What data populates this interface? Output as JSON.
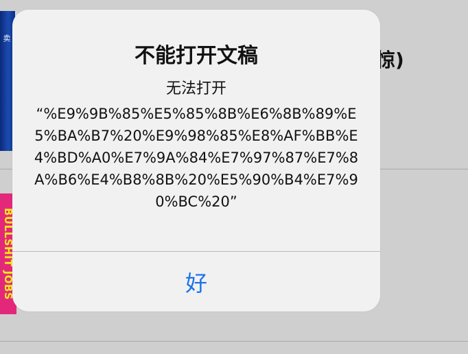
{
  "background": {
    "title_fragment": "惊)",
    "top_cover_edge_text": "卖",
    "bottom_cover_spine_text": "BULLSHIT JOBS"
  },
  "alert": {
    "title": "不能打开文稿",
    "message_intro": "无法打开",
    "message_body": "“%E9%9B%85%E5%85%8B%E6%8B%89%E5%BA%B7%20%E9%98%85%E8%AF%BB%E4%BD%A0%E7%9A%84%E7%97%87%E7%8A%B6%E4%B8%8B%20%E5%90%B4%E7%90%BC%20”",
    "ok_button": "好"
  },
  "colors": {
    "accent": "#1b73e8",
    "alert_bg": "#f1f1f2",
    "screen_bg": "#cfcfcf"
  }
}
